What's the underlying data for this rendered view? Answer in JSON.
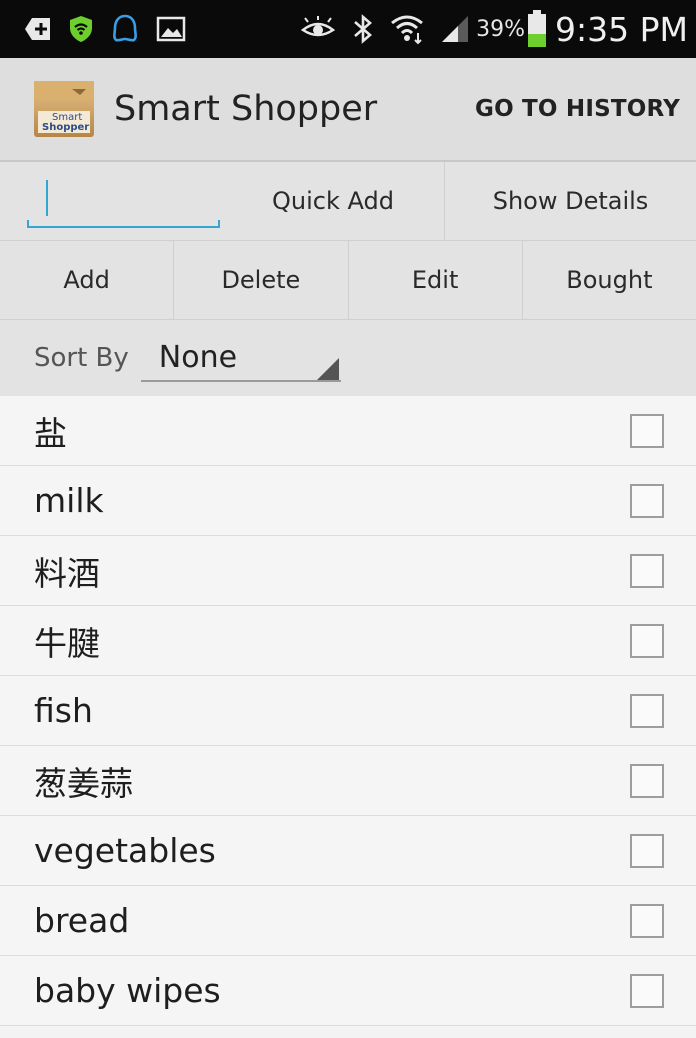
{
  "status_bar": {
    "battery_percent": "39%",
    "time": "9:35 PM",
    "icons": [
      "plus-icon",
      "wifi-security-icon",
      "message-bubble-icon",
      "image-icon",
      "eye-icon",
      "bluetooth-icon",
      "wifi-icon",
      "signal-icon",
      "battery-icon"
    ],
    "battery_level": 0.39,
    "colors": {
      "bg": "#0a0a0a",
      "shield": "#6ccf2e",
      "qq": "#3a9ee6",
      "battery": "#6ccf2e"
    }
  },
  "action_bar": {
    "logo_text_top": "Smart",
    "logo_text_bottom": "Shopper",
    "title": "Smart Shopper",
    "history_button": "GO TO HISTORY"
  },
  "toolbar": {
    "quick_add_input_value": "",
    "quick_add": "Quick Add",
    "show_details": "Show Details",
    "add": "Add",
    "delete": "Delete",
    "edit": "Edit",
    "bought": "Bought"
  },
  "sort": {
    "label": "Sort By",
    "selected": "None"
  },
  "items": [
    {
      "label": "盐",
      "checked": false
    },
    {
      "label": "milk",
      "checked": false
    },
    {
      "label": "料酒",
      "checked": false
    },
    {
      "label": "牛腱",
      "checked": false
    },
    {
      "label": "fish",
      "checked": false
    },
    {
      "label": "葱姜蒜",
      "checked": false
    },
    {
      "label": "vegetables",
      "checked": false
    },
    {
      "label": "bread",
      "checked": false
    },
    {
      "label": "baby wipes",
      "checked": false
    }
  ]
}
